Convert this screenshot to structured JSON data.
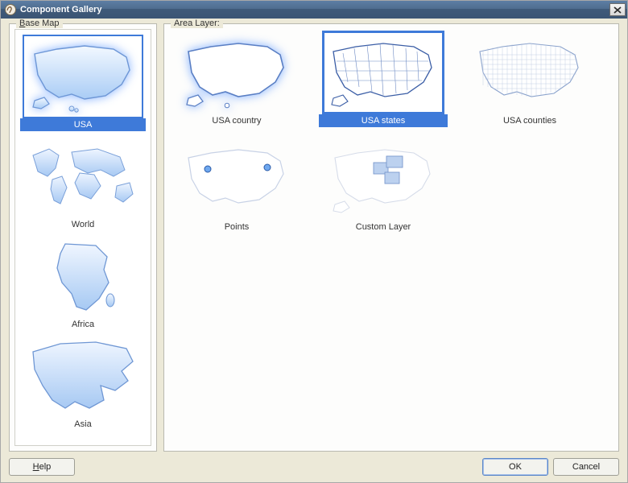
{
  "window": {
    "title": "Component Gallery"
  },
  "left": {
    "label_pre": "B",
    "label_rest": "ase Map"
  },
  "right": {
    "label": "Area Layer:"
  },
  "base_maps": [
    {
      "id": "usa",
      "label": "USA",
      "selected": true
    },
    {
      "id": "world",
      "label": "World",
      "selected": false
    },
    {
      "id": "africa",
      "label": "Africa",
      "selected": false
    },
    {
      "id": "asia",
      "label": "Asia",
      "selected": false
    }
  ],
  "area_layers": [
    {
      "id": "usa-country",
      "label": "USA country",
      "selected": false
    },
    {
      "id": "usa-states",
      "label": "USA states",
      "selected": true
    },
    {
      "id": "usa-counties",
      "label": "USA counties",
      "selected": false
    },
    {
      "id": "points",
      "label": "Points",
      "selected": false
    },
    {
      "id": "custom-layer",
      "label": "Custom Layer",
      "selected": false
    }
  ],
  "buttons": {
    "help": "Help",
    "ok": "OK",
    "cancel": "Cancel"
  }
}
